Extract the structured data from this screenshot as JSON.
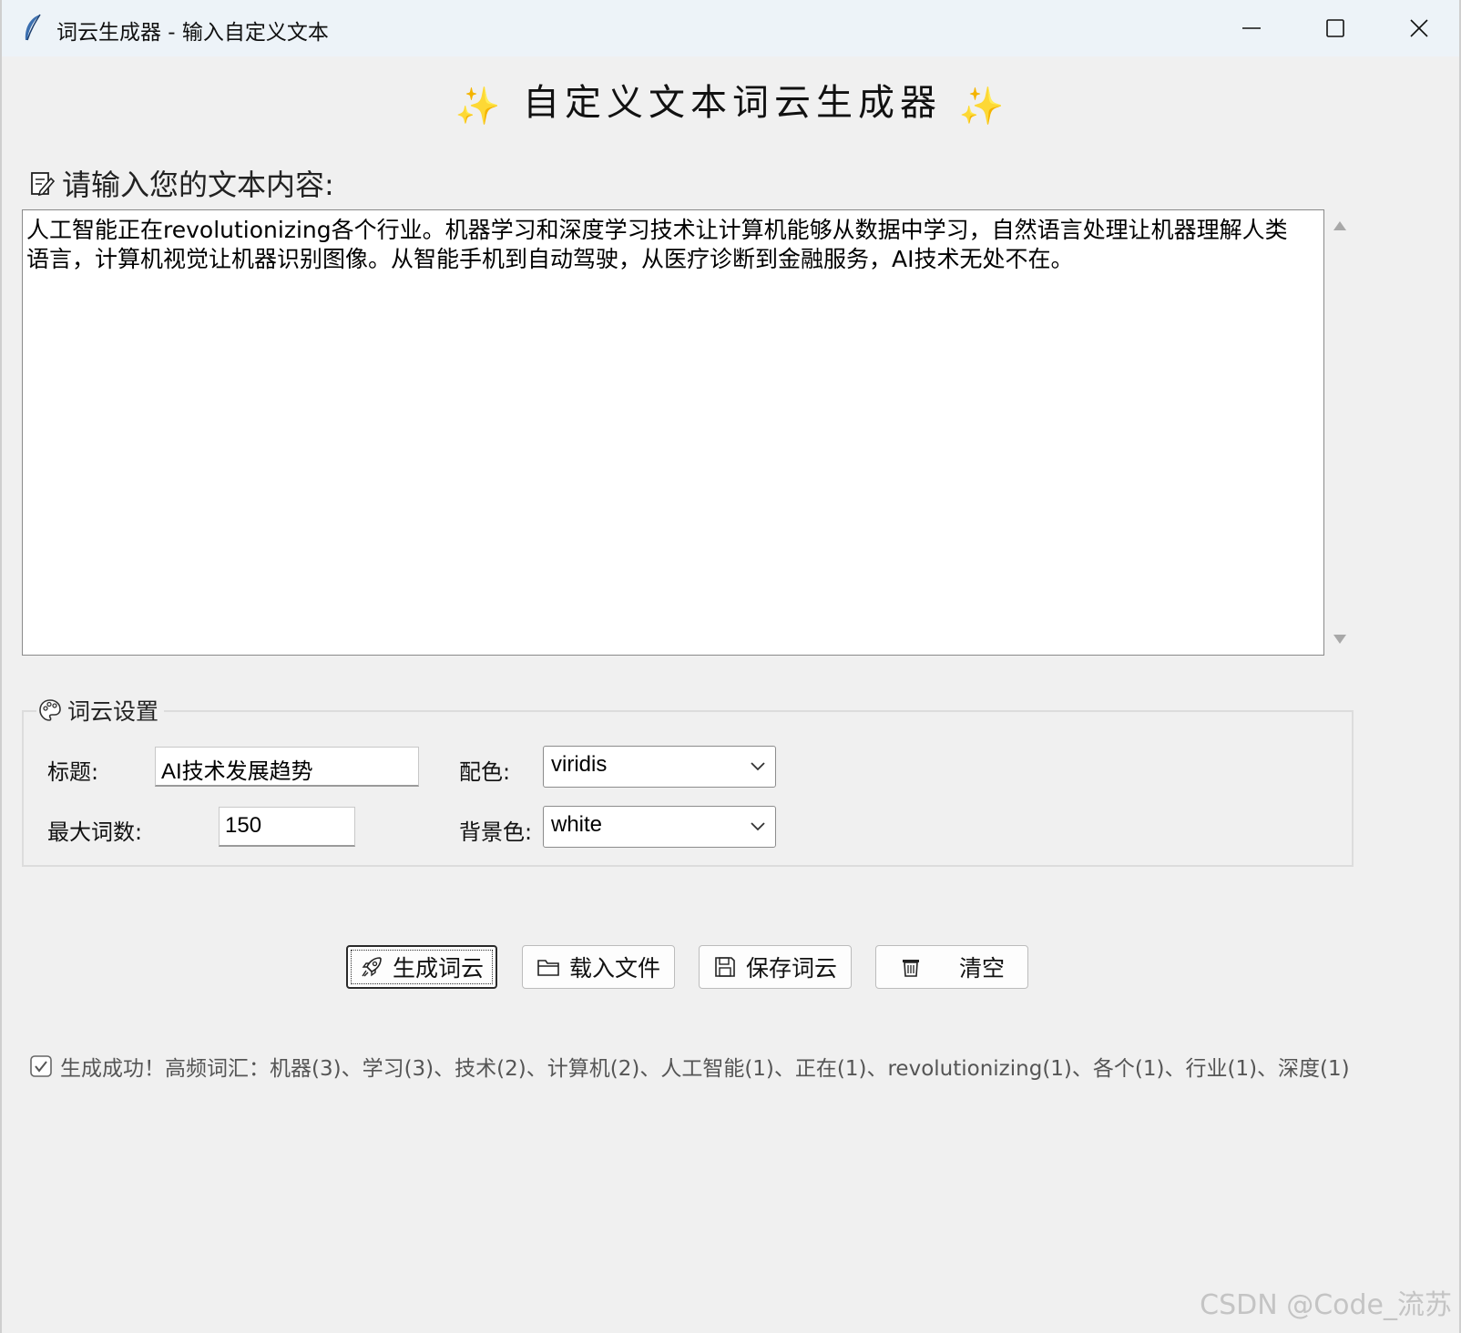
{
  "window": {
    "title": "词云生成器 - 输入自定义文本",
    "app_icon": "feather-icon"
  },
  "heading": {
    "sparkle_left": "✨",
    "text": "自定义文本词云生成器",
    "sparkle_right": "✨"
  },
  "input": {
    "label": "请输入您的文本内容:",
    "text": "人工智能正在revolutionizing各个行业。机器学习和深度学习技术让计算机能够从数据中学习，自然语言处理让机器理解人类语言，计算机视觉让机器识别图像。从智能手机到自动驾驶，从医疗诊断到金融服务，AI技术无处不在。"
  },
  "settings": {
    "legend": "词云设置",
    "title_label": "标题:",
    "title_value": "AI技术发展趋势",
    "colormap_label": "配色:",
    "colormap_value": "viridis",
    "max_words_label": "最大词数:",
    "max_words_value": "150",
    "background_label": "背景色:",
    "background_value": "white"
  },
  "buttons": {
    "generate": "生成词云",
    "load": "载入文件",
    "save": "保存词云",
    "clear": "清空"
  },
  "status": {
    "text": "生成成功！高频词汇：机器(3)、学习(3)、技术(2)、计算机(2)、人工智能(1)、正在(1)、revolutionizing(1)、各个(1)、行业(1)、深度(1)"
  },
  "watermark": "CSDN @Code_流苏"
}
